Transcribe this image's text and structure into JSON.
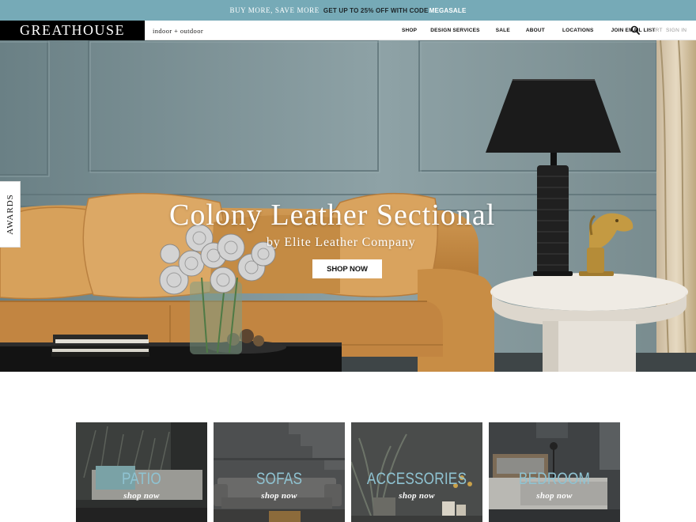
{
  "promo": {
    "part1": "BUY MORE, SAVE MORE",
    "part2": "GET UP TO 25% OFF WITH CODE",
    "part3": "MEGASALE"
  },
  "header": {
    "logo": "GREATHOUSE",
    "tagline": "indoor + outdoor",
    "nav": [
      "SHOP",
      "DESIGN SERVICES",
      "SALE",
      "ABOUT",
      "LOCATIONS",
      "JOIN EMAIL LIST"
    ],
    "cart": "CART",
    "signin": "SIGN IN",
    "search_icon": "search-icon"
  },
  "hero": {
    "title": "Colony Leather Sectional",
    "subtitle": "by Elite Leather Company",
    "cta": "SHOP NOW",
    "awards_tab": "AWARDS",
    "colors": {
      "wall": "#7b9196",
      "sofa": "#c9904a",
      "lamp": "#1c1c1c",
      "table": "#e9e4dc"
    }
  },
  "categories": [
    {
      "name": "PATIO",
      "cta": "shop now"
    },
    {
      "name": "SOFAS",
      "cta": "shop now"
    },
    {
      "name": "ACCESSORIES",
      "cta": "shop now"
    },
    {
      "name": "BEDROOM",
      "cta": "shop now"
    }
  ],
  "accent": "#76aab7"
}
